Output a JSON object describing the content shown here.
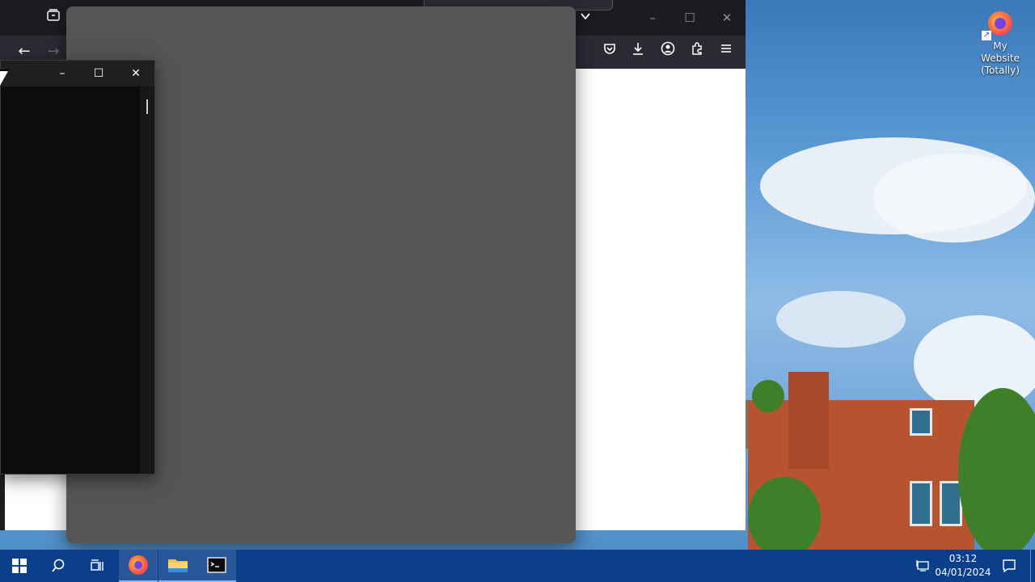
{
  "desktop": {
    "icons": [
      {
        "label": "My Website (Totally)",
        "icon": "firefox-shortcut-icon"
      }
    ]
  },
  "browser": {
    "title_controls": {
      "minimize": "–",
      "maximize": "☐",
      "close": "✕"
    },
    "nav": {
      "back": "←",
      "forward": "→"
    },
    "toolbar_icons": [
      "pocket-icon",
      "download-icon",
      "account-icon",
      "extensions-icon",
      "menu-icon"
    ]
  },
  "terminal": {
    "controls": {
      "minimize": "–",
      "maximize": "☐",
      "close": "✕"
    }
  },
  "taskbar": {
    "time": "03:12",
    "date": "04/01/2024",
    "pinned": [
      "start-button",
      "search-button",
      "task-view-button",
      "firefox-taskbar-button",
      "file-explorer-taskbar-button",
      "terminal-taskbar-button"
    ]
  },
  "colors": {
    "taskbar": "#0b3f8a",
    "browser_chrome": "#1c1b22",
    "gray_panel": "#555555",
    "terminal_bg": "#0c0c0c"
  }
}
